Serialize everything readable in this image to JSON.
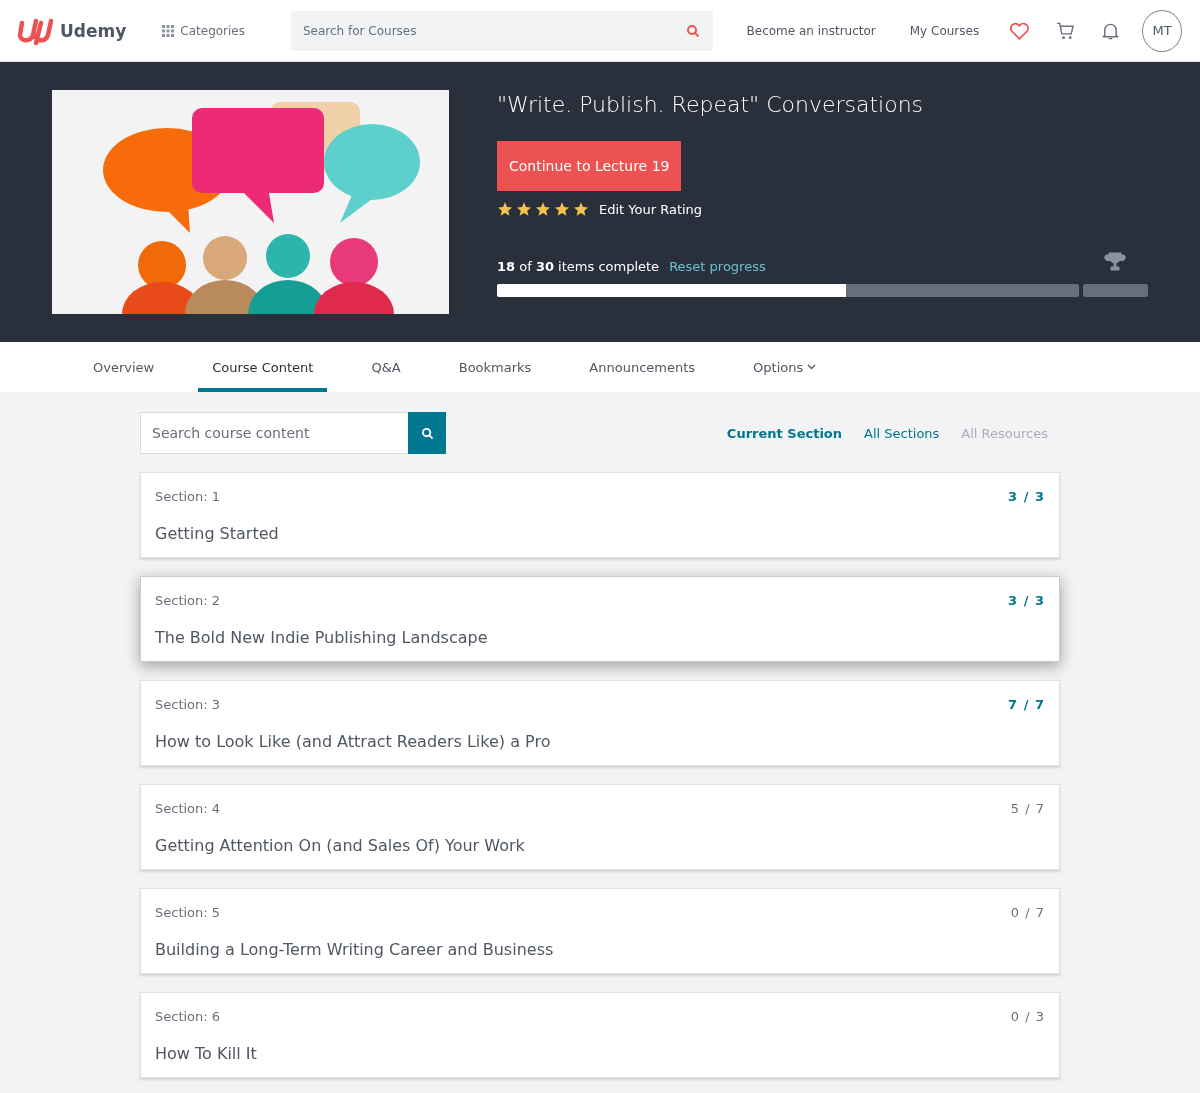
{
  "header": {
    "logo": "Udemy",
    "categories": "Categories",
    "search": {
      "placeholder": "Search for Courses"
    },
    "links": [
      "Become an instructor",
      "My Courses"
    ],
    "avatar": "MT"
  },
  "course": {
    "title": "\"Write. Publish. Repeat\" Conversations",
    "continue_button": "Continue to Lecture 19",
    "stars": 5,
    "rating_link": "Edit Your Rating",
    "progress_text": "**18** of **30** items complete",
    "reset_link": "Reset progress",
    "progress": {
      "level": 0.6
    }
  },
  "tabs": [
    {
      "label": "Overview",
      "selected": false
    },
    {
      "label": "Course Content",
      "selected": true
    },
    {
      "label": "Q&A",
      "selected": false
    },
    {
      "label": "Bookmarks",
      "selected": false
    },
    {
      "label": "Announcements",
      "selected": false
    },
    {
      "label": "Options",
      "selected": false,
      "kind": "dropdown"
    }
  ],
  "content_search": {
    "placeholder": "Search course content"
  },
  "filters": [
    {
      "label": "Current Section",
      "selected": true,
      "disabled": false
    },
    {
      "label": "All Sections",
      "selected": false,
      "disabled": false
    },
    {
      "label": "All Resources",
      "selected": false,
      "disabled": true
    }
  ],
  "sections": [
    {
      "number": "Section: 1",
      "title": "Getting Started",
      "count": "3 / 3",
      "complete": true,
      "highlighted": false
    },
    {
      "number": "Section: 2",
      "title": "The Bold New Indie Publishing Landscape",
      "count": "3 / 3",
      "complete": true,
      "highlighted": true
    },
    {
      "number": "Section: 3",
      "title": "How to Look Like (and Attract Readers Like) a Pro",
      "count": "7 / 7",
      "complete": true,
      "highlighted": false
    },
    {
      "number": "Section: 4",
      "title": "Getting Attention On (and Sales Of) Your Work",
      "count": "5 / 7",
      "complete": false,
      "highlighted": false
    },
    {
      "number": "Section: 5",
      "title": "Building a Long-Term Writing Career and Business",
      "count": "0 / 7",
      "complete": false,
      "highlighted": false
    },
    {
      "number": "Section: 6",
      "title": "How To Kill It",
      "count": "0 / 3",
      "complete": false,
      "highlighted": false
    }
  ]
}
